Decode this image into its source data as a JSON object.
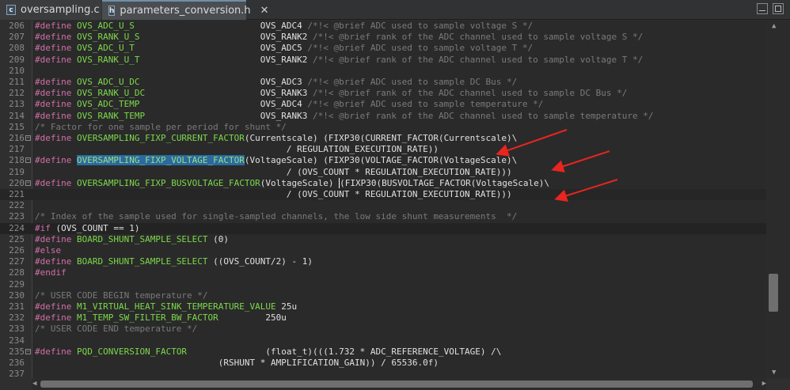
{
  "tabs": [
    {
      "label": "oversampling.c",
      "icon": "c-file-icon",
      "icon_text": "c",
      "active": false
    },
    {
      "label": "parameters_conversion.h",
      "icon": "h-file-icon",
      "icon_text": "h",
      "active": true,
      "close": "✕"
    }
  ],
  "colors": {
    "keyword": "#d26fa7",
    "macro": "#7cd94a",
    "comment": "#7a7a7a",
    "annotation_arrow": "#e8251f"
  },
  "lines": [
    {
      "n": "206",
      "segs": [
        [
          "kw",
          "#define"
        ],
        [
          "",
          ""
        ],
        [
          "mac",
          "OVS_ADC_U_S"
        ],
        [
          "",
          "                        OVS_ADC4 "
        ],
        [
          "cm",
          "/*!< @brief ADC used to sample voltage S */"
        ]
      ]
    },
    {
      "n": "207",
      "segs": [
        [
          "kw",
          "#define"
        ],
        [
          "",
          ""
        ],
        [
          "mac",
          "OVS_RANK_U_S"
        ],
        [
          "",
          "                       OVS_RANK2 "
        ],
        [
          "cm",
          "/*!< @brief rank of the ADC channel used to sample voltage S */"
        ]
      ]
    },
    {
      "n": "208",
      "segs": [
        [
          "kw",
          "#define"
        ],
        [
          "",
          ""
        ],
        [
          "mac",
          "OVS_ADC_U_T"
        ],
        [
          "",
          "                        OVS_ADC5 "
        ],
        [
          "cm",
          "/*!< @brief ADC used to sample voltage T */"
        ]
      ]
    },
    {
      "n": "209",
      "segs": [
        [
          "kw",
          "#define"
        ],
        [
          "",
          ""
        ],
        [
          "mac",
          "OVS_RANK_U_T"
        ],
        [
          "",
          "                       OVS_RANK2 "
        ],
        [
          "cm",
          "/*!< @brief rank of the ADC channel used to sample voltage T */"
        ]
      ]
    },
    {
      "n": "210",
      "segs": []
    },
    {
      "n": "211",
      "segs": [
        [
          "kw",
          "#define"
        ],
        [
          "",
          ""
        ],
        [
          "mac",
          "OVS_ADC_U_DC"
        ],
        [
          "",
          "                       OVS_ADC3 "
        ],
        [
          "cm",
          "/*!< @brief ADC used to sample DC Bus */"
        ]
      ]
    },
    {
      "n": "212",
      "segs": [
        [
          "kw",
          "#define"
        ],
        [
          "",
          ""
        ],
        [
          "mac",
          "OVS_RANK_U_DC"
        ],
        [
          "",
          "                      OVS_RANK3 "
        ],
        [
          "cm",
          "/*!< @brief rank of the ADC channel used to sample DC Bus */"
        ]
      ]
    },
    {
      "n": "213",
      "segs": [
        [
          "kw",
          "#define"
        ],
        [
          "",
          ""
        ],
        [
          "mac",
          "OVS_ADC_TEMP"
        ],
        [
          "",
          "                       OVS_ADC4 "
        ],
        [
          "cm",
          "/*!< @brief ADC used to sample temperature */"
        ]
      ]
    },
    {
      "n": "214",
      "segs": [
        [
          "kw",
          "#define"
        ],
        [
          "",
          ""
        ],
        [
          "mac",
          "OVS_RANK_TEMP"
        ],
        [
          "",
          "                      OVS_RANK3 "
        ],
        [
          "cm",
          "/*!< @brief rank of the ADC channel used to sample temperature */"
        ]
      ]
    },
    {
      "n": "215",
      "segs": [
        [
          "cm",
          "/* Factor for one sample per period for shunt */"
        ]
      ]
    },
    {
      "n": "216",
      "fold": "−",
      "segs": [
        [
          "kw",
          "#define"
        ],
        [
          "",
          ""
        ],
        [
          "mac",
          "OVERSAMPLING_FIXP_CURRENT_FACTOR"
        ],
        [
          "",
          "(Currentscale) (FIXP30(CURRENT_FACTOR(Currentscale)\\"
        ]
      ]
    },
    {
      "n": "217",
      "segs": [
        [
          "",
          "                                                / REGULATION_EXECUTION_RATE))"
        ]
      ]
    },
    {
      "n": "218",
      "fold": "−",
      "segs": [
        [
          "kw",
          "#define"
        ],
        [
          "",
          ""
        ],
        [
          "hl",
          "OVERSAMPLING_FIXP_VOLTAGE_FACTOR"
        ],
        [
          "",
          "(VoltageScale) (FIXP30(VOLTAGE_FACTOR(VoltageScale)\\"
        ]
      ]
    },
    {
      "n": "219",
      "segs": [
        [
          "",
          "                                                / (OVS_COUNT * REGULATION_EXECUTION_RATE)))"
        ]
      ]
    },
    {
      "n": "220",
      "fold": "−",
      "segs": [
        [
          "kw",
          "#define"
        ],
        [
          "",
          ""
        ],
        [
          "mac",
          "OVERSAMPLING_FIXP_BUSVOLTAGE_FACTOR"
        ],
        [
          "",
          "(VoltageScale) "
        ],
        [
          "caret",
          ""
        ],
        [
          "",
          "(FIXP30(BUSVOLTAGE_FACTOR(VoltageScale)\\"
        ]
      ]
    },
    {
      "n": "221",
      "cur": true,
      "segs": [
        [
          "",
          "                                                / (OVS_COUNT * REGULATION_EXECUTION_RATE)))"
        ]
      ]
    },
    {
      "n": "222",
      "segs": []
    },
    {
      "n": "223",
      "segs": [
        [
          "cm",
          "/* Index of the sample used for single-sampled channels, the low side shunt measurements  */"
        ]
      ]
    },
    {
      "n": "224",
      "sel": true,
      "segs": [
        [
          "kw",
          "#if"
        ],
        [
          "",
          " (OVS_COUNT == 1)"
        ]
      ]
    },
    {
      "n": "225",
      "segs": [
        [
          "kw",
          "#define"
        ],
        [
          "",
          ""
        ],
        [
          "mac",
          "BOARD_SHUNT_SAMPLE_SELECT"
        ],
        [
          "",
          " (0)"
        ]
      ]
    },
    {
      "n": "226",
      "segs": [
        [
          "kw",
          "#else"
        ]
      ]
    },
    {
      "n": "227",
      "segs": [
        [
          "kw",
          "#define"
        ],
        [
          "",
          ""
        ],
        [
          "mac",
          "BOARD_SHUNT_SAMPLE_SELECT"
        ],
        [
          "",
          " ((OVS_COUNT/2) - 1)"
        ]
      ]
    },
    {
      "n": "228",
      "segs": [
        [
          "kw",
          "#endif"
        ]
      ]
    },
    {
      "n": "229",
      "segs": []
    },
    {
      "n": "230",
      "segs": [
        [
          "cm",
          "/* USER CODE BEGIN temperature */"
        ]
      ]
    },
    {
      "n": "231",
      "segs": [
        [
          "kw",
          "#define"
        ],
        [
          "",
          ""
        ],
        [
          "mac",
          "M1_VIRTUAL_HEAT_SINK_TEMPERATURE_VALUE"
        ],
        [
          "",
          " 25u"
        ]
      ]
    },
    {
      "n": "232",
      "segs": [
        [
          "kw",
          "#define"
        ],
        [
          "",
          ""
        ],
        [
          "mac",
          "M1_TEMP_SW_FILTER_BW_FACTOR"
        ],
        [
          "",
          "         250u"
        ]
      ]
    },
    {
      "n": "233",
      "segs": [
        [
          "cm",
          "/* USER CODE END temperature */"
        ]
      ]
    },
    {
      "n": "234",
      "segs": []
    },
    {
      "n": "235",
      "fold": "−",
      "segs": [
        [
          "kw",
          "#define"
        ],
        [
          "",
          ""
        ],
        [
          "mac",
          "PQD_CONVERSION_FACTOR"
        ],
        [
          "",
          "               (float_t)(((1.732 * ADC_REFERENCE_VOLTAGE) /\\"
        ]
      ]
    },
    {
      "n": "236",
      "segs": [
        [
          "",
          "                                   (RSHUNT * AMPLIFICATION_GAIN)) / 65536.0f)"
        ]
      ]
    },
    {
      "n": "237",
      "segs": []
    }
  ]
}
